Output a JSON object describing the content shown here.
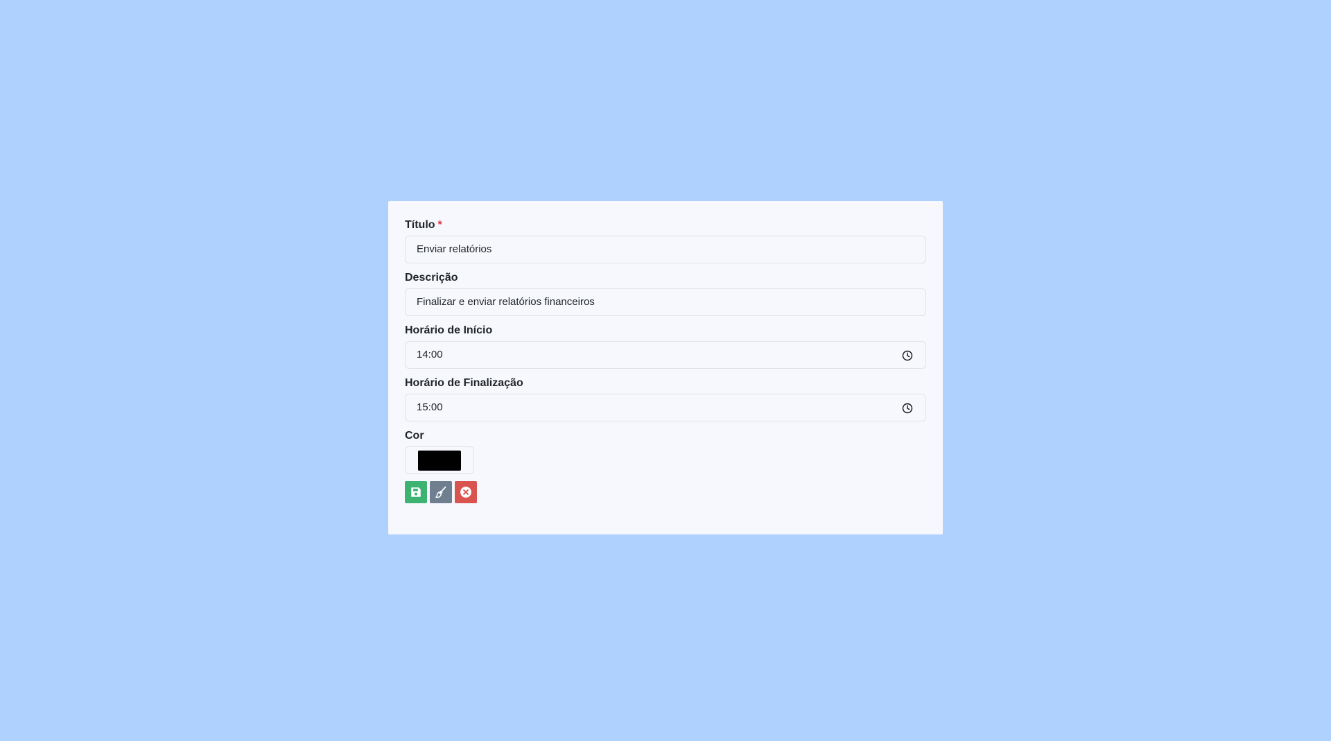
{
  "form": {
    "title_label": "Título",
    "required_mark": "*",
    "title_value": "Enviar relatórios",
    "description_label": "Descrição",
    "description_value": "Finalizar e enviar relatórios financeiros",
    "start_label": "Horário de Início",
    "start_value": "14:00",
    "end_label": "Horário de Finalização",
    "end_value": "15:00",
    "color_label": "Cor",
    "color_value": "#000000"
  },
  "actions": {
    "save_icon": "save-icon",
    "clear_icon": "broom-icon",
    "cancel_icon": "close-circle-icon"
  },
  "colors": {
    "background": "#aed1fe",
    "card": "#f6f8fd",
    "save": "#3cb371",
    "clear": "#6f7f8f",
    "cancel": "#d9534f",
    "required": "#dc3545"
  }
}
